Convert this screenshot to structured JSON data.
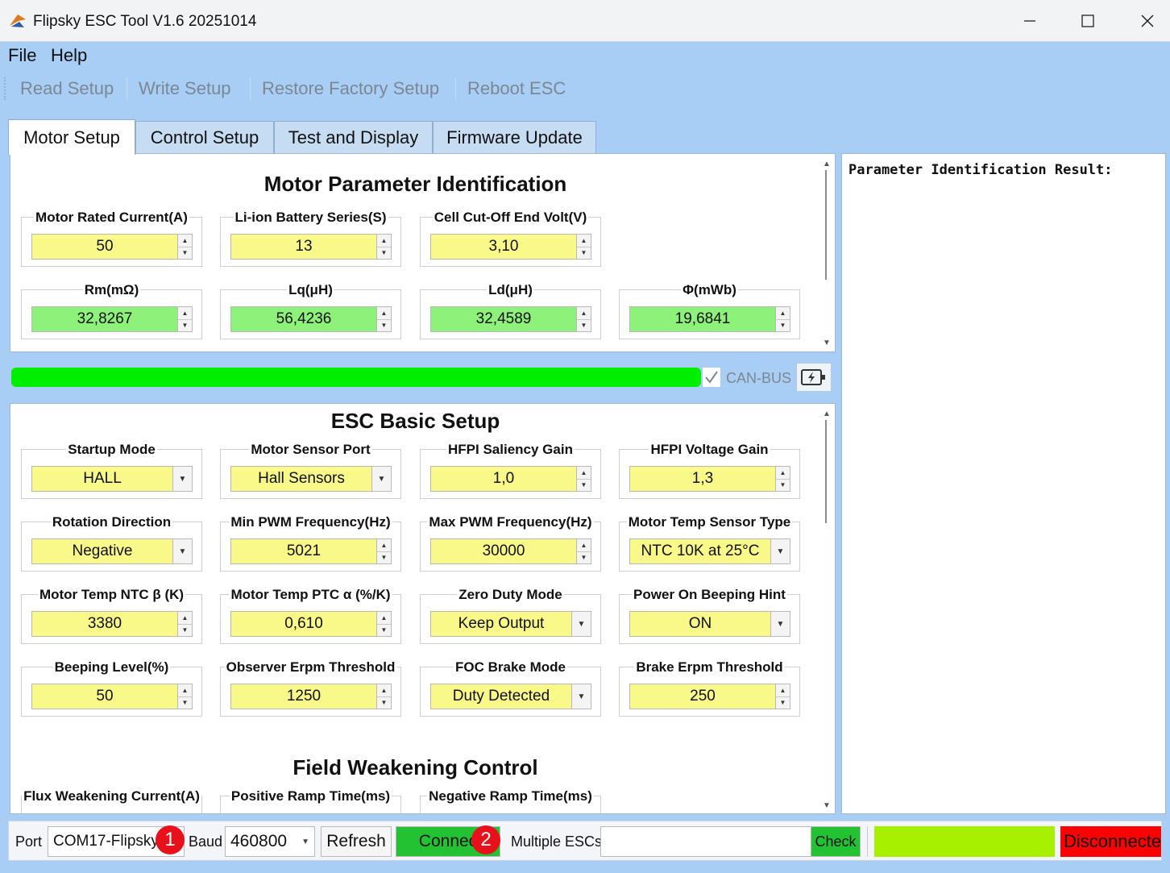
{
  "window": {
    "title": "Flipsky ESC Tool V1.6 20251014",
    "minimize_icon": "minimize-icon",
    "maximize_icon": "maximize-icon",
    "close_icon": "close-icon"
  },
  "menu": {
    "items": [
      "File",
      "Help"
    ]
  },
  "toolbar": {
    "items": [
      "Read Setup",
      "Write Setup",
      "Restore Factory Setup",
      "Reboot ESC"
    ]
  },
  "tabs": {
    "items": [
      "Motor Setup",
      "Control Setup",
      "Test and Display",
      "Firmware Update"
    ],
    "active": "Motor Setup"
  },
  "motor_param": {
    "title": "Motor Parameter Identification",
    "fields": [
      {
        "label": "Motor Rated Current(A)",
        "value": "50",
        "color": "#f9f98a"
      },
      {
        "label": "Li-ion Battery Series(S)",
        "value": "13",
        "color": "#f9f98a"
      },
      {
        "label": "Cell Cut-Off End Volt(V)",
        "value": "3,10",
        "color": "#f9f98a"
      },
      {
        "label": "Rm(mΩ)",
        "value": "32,8267",
        "color": "#8ef27a"
      },
      {
        "label": "Lq(μH)",
        "value": "56,4236",
        "color": "#8ef27a"
      },
      {
        "label": "Ld(μH)",
        "value": "32,4589",
        "color": "#8ef27a"
      },
      {
        "label": "Φ(mWb)",
        "value": "19,6841",
        "color": "#8ef27a"
      }
    ]
  },
  "progress": {
    "fraction": 1.0,
    "color": "#00ee00",
    "can_label": "CAN-BUS",
    "can_checked": true,
    "battery_icon": "battery-charge-icon"
  },
  "esc_basic": {
    "title": "ESC Basic Setup",
    "fields": [
      {
        "label": "Startup Mode",
        "value": "HALL",
        "kind": "combo"
      },
      {
        "label": "Motor Sensor Port",
        "value": "Hall Sensors",
        "kind": "combo"
      },
      {
        "label": "HFPI Saliency Gain",
        "value": "1,0",
        "kind": "spin"
      },
      {
        "label": "HFPI Voltage Gain",
        "value": "1,3",
        "kind": "spin"
      },
      {
        "label": "Rotation Direction",
        "value": "Negative",
        "kind": "combo"
      },
      {
        "label": "Min PWM Frequency(Hz)",
        "value": "5021",
        "kind": "spin"
      },
      {
        "label": "Max PWM Frequency(Hz)",
        "value": "30000",
        "kind": "spin"
      },
      {
        "label": "Motor Temp Sensor Type",
        "value": "NTC 10K at 25°C",
        "kind": "combo"
      },
      {
        "label": "Motor Temp NTC β (K)",
        "value": "3380",
        "kind": "spin"
      },
      {
        "label": "Motor Temp PTC α (%/K)",
        "value": "0,610",
        "kind": "spin"
      },
      {
        "label": "Zero Duty Mode",
        "value": "Keep Output",
        "kind": "combo"
      },
      {
        "label": "Power On Beeping Hint",
        "value": "ON",
        "kind": "combo"
      },
      {
        "label": "Beeping Level(%)",
        "value": "50",
        "kind": "spin"
      },
      {
        "label": "Observer Erpm Threshold",
        "value": "1250",
        "kind": "spin"
      },
      {
        "label": "FOC Brake Mode",
        "value": "Duty Detected",
        "kind": "combo"
      },
      {
        "label": "Brake Erpm Threshold",
        "value": "250",
        "kind": "spin"
      }
    ]
  },
  "field_weakening": {
    "title": "Field Weakening Control",
    "fields": [
      {
        "label": "Flux Weakening Current(A)"
      },
      {
        "label": "Positive Ramp Time(ms)"
      },
      {
        "label": "Negative Ramp Time(ms)"
      }
    ]
  },
  "result": {
    "title": "Parameter Identification Result:"
  },
  "statusbar": {
    "port_label": "Port",
    "port_value": "COM17-Flipsky",
    "baud_label": "Baud",
    "baud_value": "460800",
    "refresh_label": "Refresh",
    "connect_label": "Connec",
    "multiple_label": "Multiple ESCs",
    "multiple_value": "",
    "check_label": "Check",
    "status_label": "Disconnected",
    "status_color": "#ff0000",
    "indicator_color": "#a6f000",
    "connect_color": "#22c232",
    "badge1": "1",
    "badge2": "2"
  }
}
